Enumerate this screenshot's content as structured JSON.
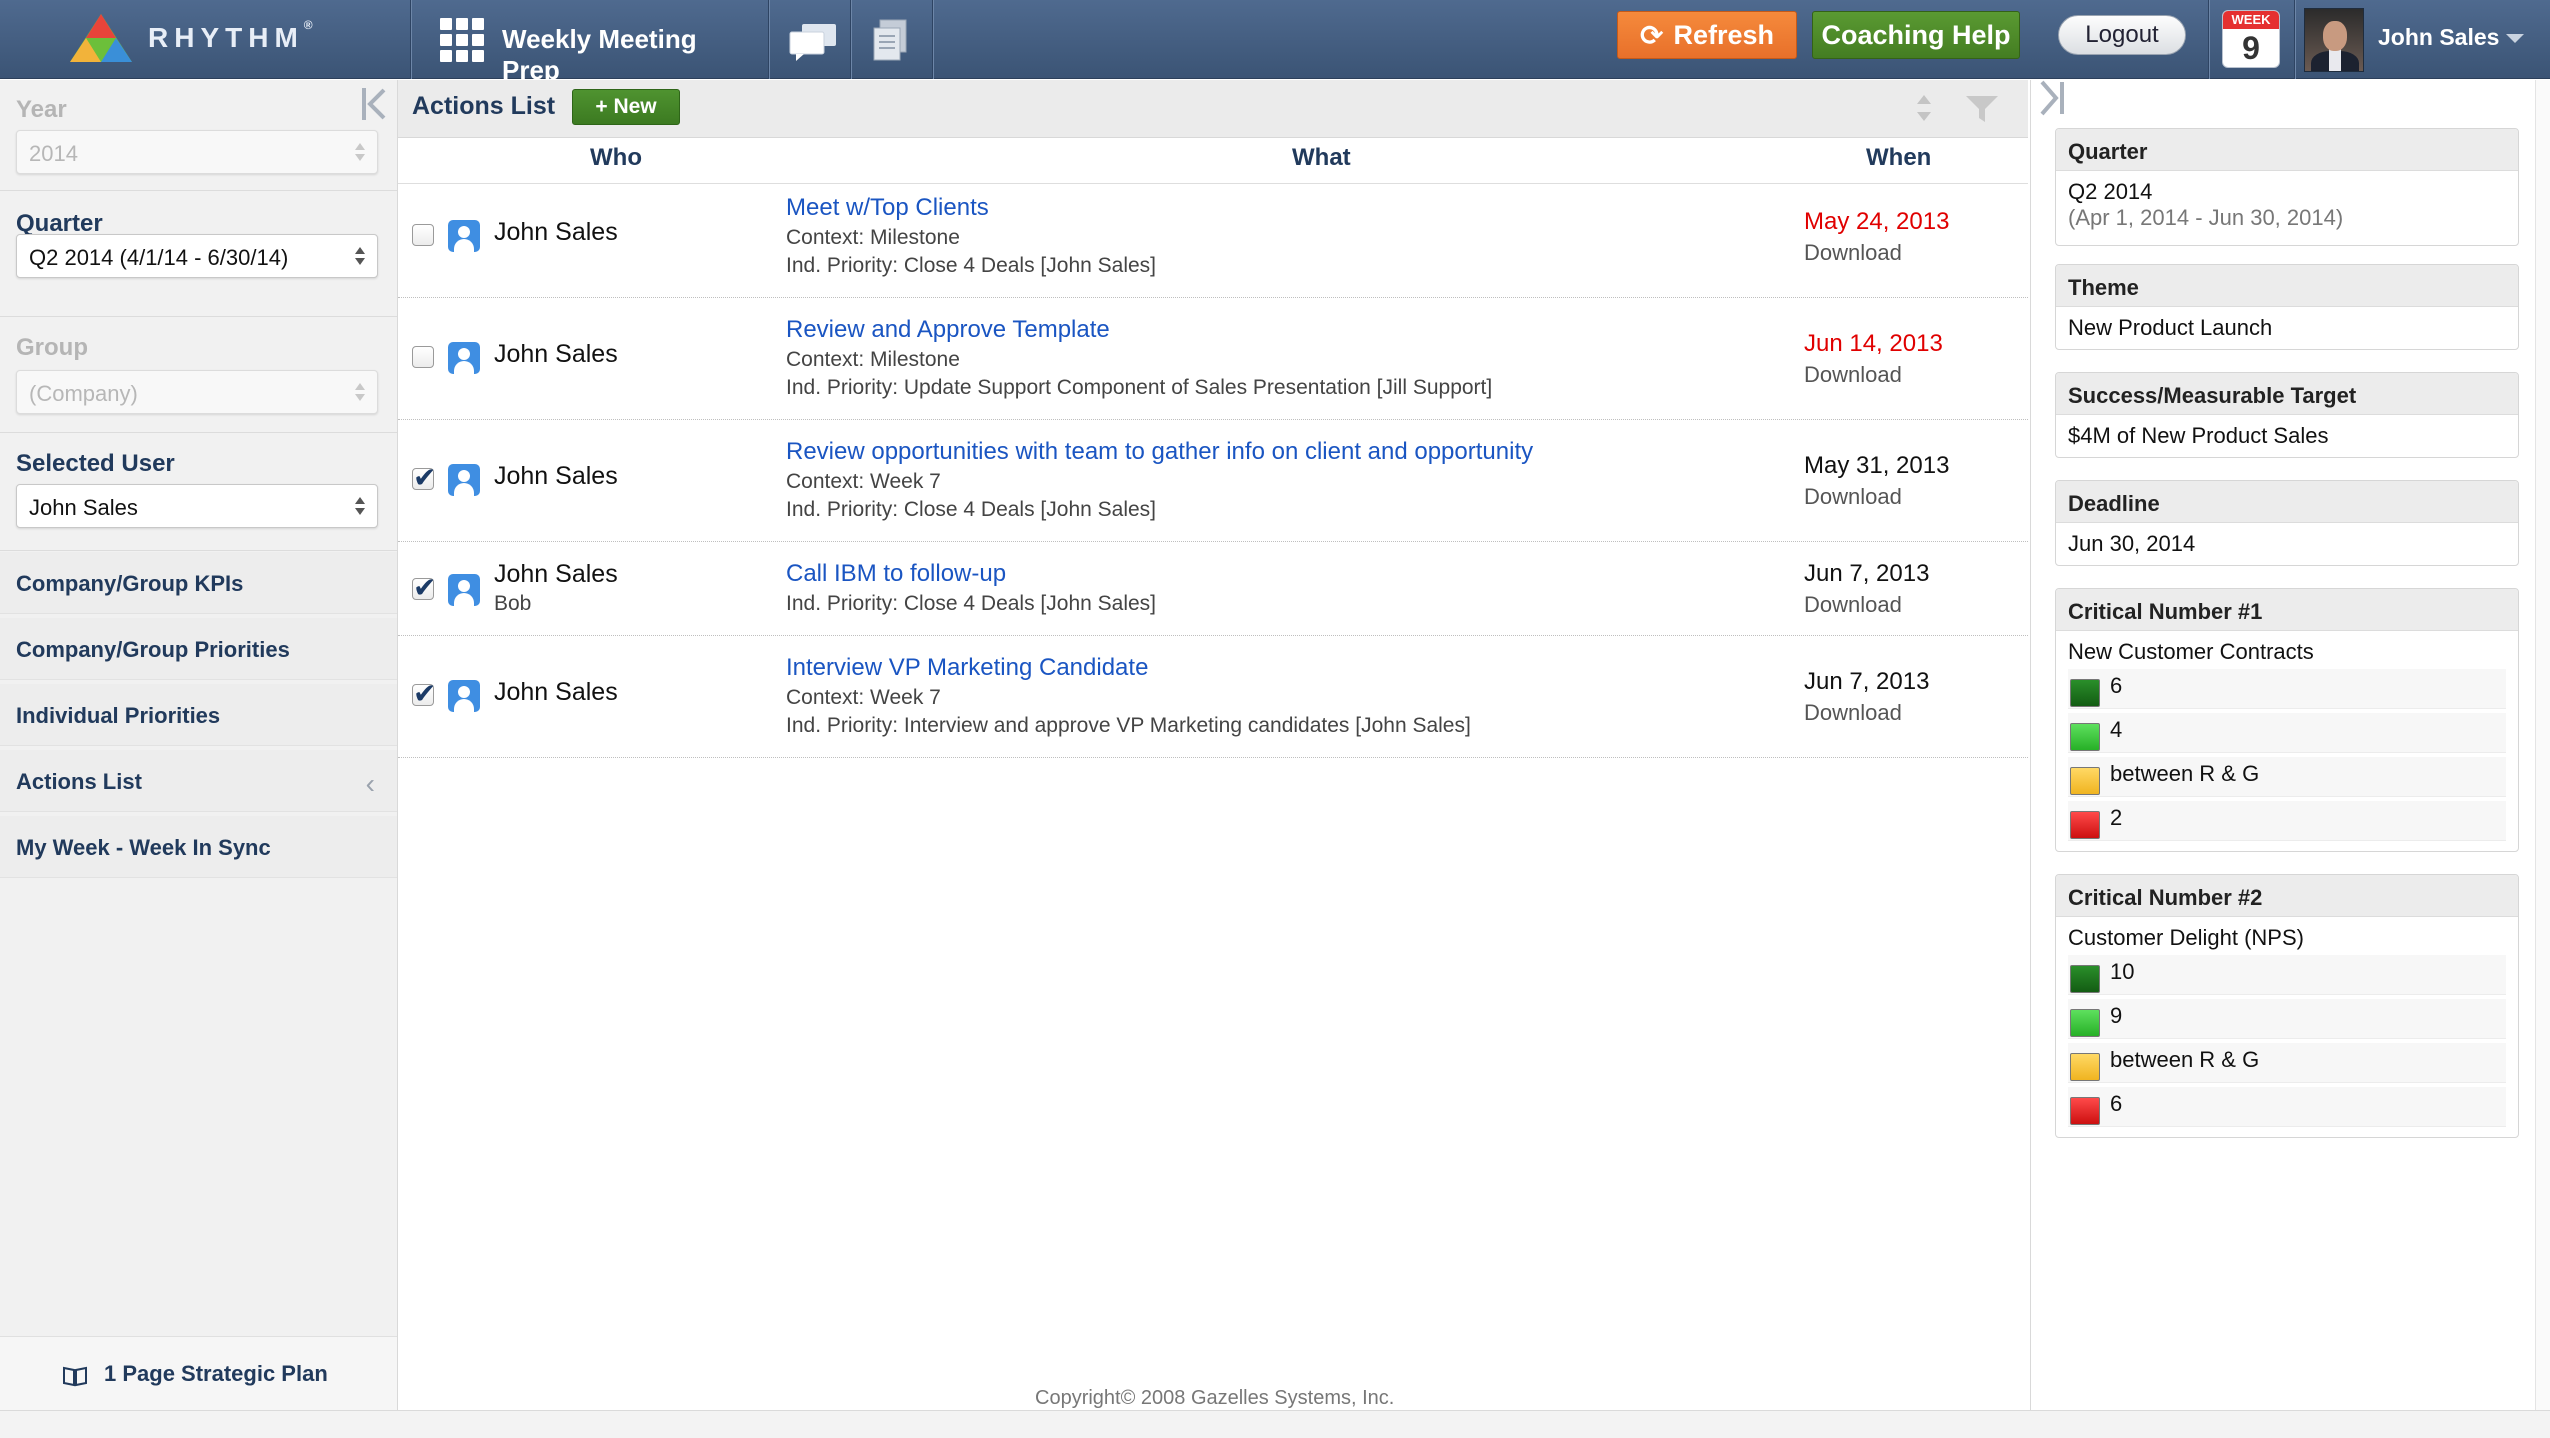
{
  "app": {
    "logo_text": "RHYTHM",
    "logo_mark": "®",
    "module": "Weekly Meeting Prep",
    "refresh_label": "Refresh",
    "coaching_label": "Coaching Help",
    "logout_label": "Logout",
    "week_label": "WEEK",
    "week_number": "9",
    "user_name": "John Sales",
    "colors": {
      "topbar": "#45607f",
      "refresh": "#ef7a32",
      "coaching": "#4e8c2a",
      "link": "#1a55c2",
      "overdue": "#e00000"
    }
  },
  "sidebar": {
    "year": {
      "label": "Year",
      "value": "2014"
    },
    "quarter": {
      "label": "Quarter",
      "value": "Q2 2014 (4/1/14 - 6/30/14)"
    },
    "group": {
      "label": "Group",
      "placeholder": "(Company)"
    },
    "selected_user": {
      "label": "Selected User",
      "value": "John Sales"
    },
    "nav": [
      {
        "label": "Company/Group KPIs"
      },
      {
        "label": "Company/Group Priorities"
      },
      {
        "label": "Individual Priorities"
      },
      {
        "label": "Actions List",
        "active": true
      },
      {
        "label": "My Week - Week In Sync"
      }
    ],
    "plan_link": "1 Page Strategic Plan"
  },
  "main": {
    "title": "Actions List",
    "new_label": "+ New",
    "columns": {
      "who": "Who",
      "what": "What",
      "when": "When"
    },
    "rows": [
      {
        "checked": false,
        "who": "John Sales",
        "who_sub": "",
        "title": "Meet w/Top Clients",
        "context": "Context: Milestone",
        "priority": "Ind. Priority: Close 4 Deals [John Sales]",
        "date": "May 24, 2013",
        "overdue": true,
        "download": "Download"
      },
      {
        "checked": false,
        "who": "John Sales",
        "who_sub": "",
        "title": "Review and Approve Template",
        "context": "Context: Milestone",
        "priority": "Ind. Priority: Update Support Component of Sales Presentation [Jill Support]",
        "date": "Jun 14, 2013",
        "overdue": true,
        "download": "Download"
      },
      {
        "checked": true,
        "who": "John Sales",
        "who_sub": "",
        "title": "Review opportunities with team to gather info on client and opportunity",
        "context": "Context: Week 7",
        "priority": "Ind. Priority: Close 4 Deals [John Sales]",
        "date": "May 31, 2013",
        "overdue": false,
        "download": "Download"
      },
      {
        "checked": true,
        "who": "John Sales",
        "who_sub": "Bob",
        "title": "Call IBM to follow-up",
        "context": "",
        "priority": "Ind. Priority: Close 4 Deals [John Sales]",
        "date": "Jun 7, 2013",
        "overdue": false,
        "download": "Download"
      },
      {
        "checked": true,
        "who": "John Sales",
        "who_sub": "",
        "title": "Interview VP Marketing Candidate",
        "context": "Context: Week 7",
        "priority": "Ind. Priority: Interview and approve VP Marketing candidates [John Sales]",
        "date": "Jun 7, 2013",
        "overdue": false,
        "download": "Download"
      }
    ],
    "copyright": "Copyright© 2008 Gazelles Systems, Inc."
  },
  "right": {
    "quarter": {
      "title": "Quarter",
      "value": "Q2 2014",
      "range": "(Apr 1, 2014 - Jun 30, 2014)"
    },
    "theme": {
      "title": "Theme",
      "value": "New Product Launch"
    },
    "target": {
      "title": "Success/Measurable Target",
      "value": "$4M of New Product Sales"
    },
    "deadline": {
      "title": "Deadline",
      "value": "Jun 30, 2014"
    },
    "cn1": {
      "title": "Critical Number #1",
      "name": "New Customer Contracts",
      "levels": [
        {
          "color": "#1a7a1a",
          "text": "6"
        },
        {
          "color": "#3cc83c",
          "text": "4"
        },
        {
          "color": "#f5c542",
          "text": "between R & G"
        },
        {
          "color": "#e02020",
          "text": "2"
        }
      ]
    },
    "cn2": {
      "title": "Critical Number #2",
      "name": "Customer Delight (NPS)",
      "levels": [
        {
          "color": "#1a7a1a",
          "text": "10"
        },
        {
          "color": "#3cc83c",
          "text": "9"
        },
        {
          "color": "#f5c542",
          "text": "between R & G"
        },
        {
          "color": "#e02020",
          "text": "6"
        }
      ]
    }
  }
}
